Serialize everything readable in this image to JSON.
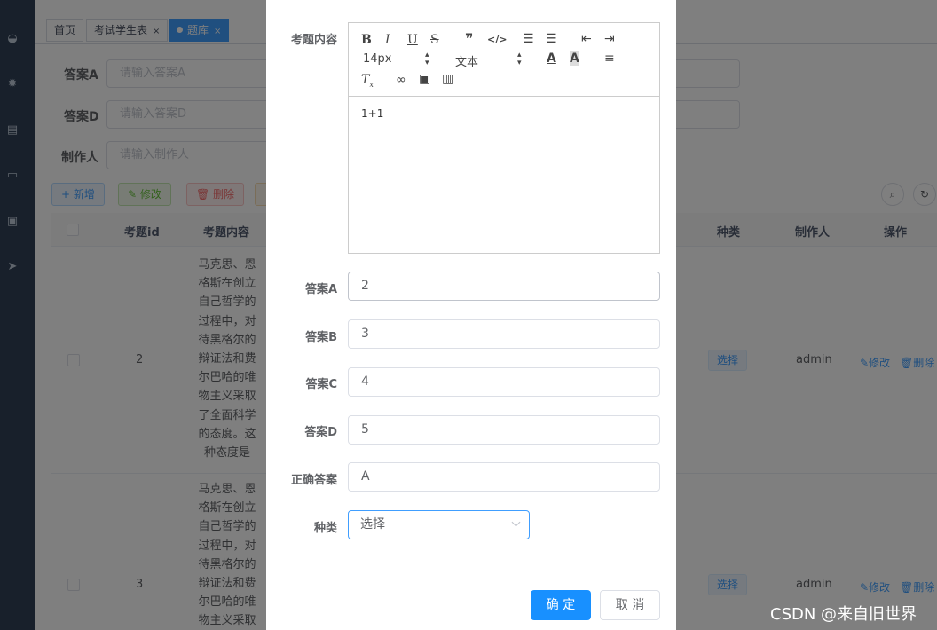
{
  "tags": [
    {
      "label": "首页"
    },
    {
      "label": "考试学生表",
      "close": "×"
    },
    {
      "label": "题库",
      "close": "×",
      "active": true
    }
  ],
  "search": {
    "answer_a_label": "答案A",
    "answer_a_placeholder": "请输入答案A",
    "answer_d_label": "答案D",
    "answer_d_placeholder": "请输入答案D",
    "creator_label": "制作人",
    "creator_placeholder": "请输入制作人"
  },
  "actions": {
    "add": "+ 新增",
    "edit": "✎ 修改",
    "delete": "🗑 删除"
  },
  "table": {
    "columns": {
      "id": "考题id",
      "content": "考题内容",
      "type": "种类",
      "creator": "制作人",
      "ops": "操作"
    },
    "rows": [
      {
        "id": "2",
        "content": "马克思、恩格斯在创立自己哲学的过程中，对待黑格尔的辩证法和费尔巴哈的唯物主义采取了全面科学的态度。这种态度是",
        "type": "选择",
        "creator": "admin",
        "edit": "✎修改",
        "delete": "🗑删除"
      },
      {
        "id": "3",
        "content": "马克思、恩格斯在创立自己哲学的过程中，对待黑格尔的辩证法和费尔巴哈的唯物主义采取",
        "type": "选择",
        "creator": "admin",
        "edit": "✎修改",
        "delete": "🗑删除"
      }
    ]
  },
  "dialog": {
    "content_label": "考题内容",
    "toolbar": {
      "font_size": "14px",
      "block_type": "文本"
    },
    "editor_text": "1+1",
    "answer_a_label": "答案A",
    "answer_a_value": "2",
    "answer_b_label": "答案B",
    "answer_b_value": "3",
    "answer_c_label": "答案C",
    "answer_c_value": "4",
    "answer_d_label": "答案D",
    "answer_d_value": "5",
    "correct_label": "正确答案",
    "correct_value": "A",
    "type_label": "种类",
    "type_value": "选择",
    "confirm": "确 定",
    "cancel": "取 消"
  },
  "watermark": "CSDN @来自旧世界",
  "colors": {
    "primary": "#1890ff",
    "sidebar": "#304156",
    "overlay": "rgba(0,0,0,0.5)"
  }
}
